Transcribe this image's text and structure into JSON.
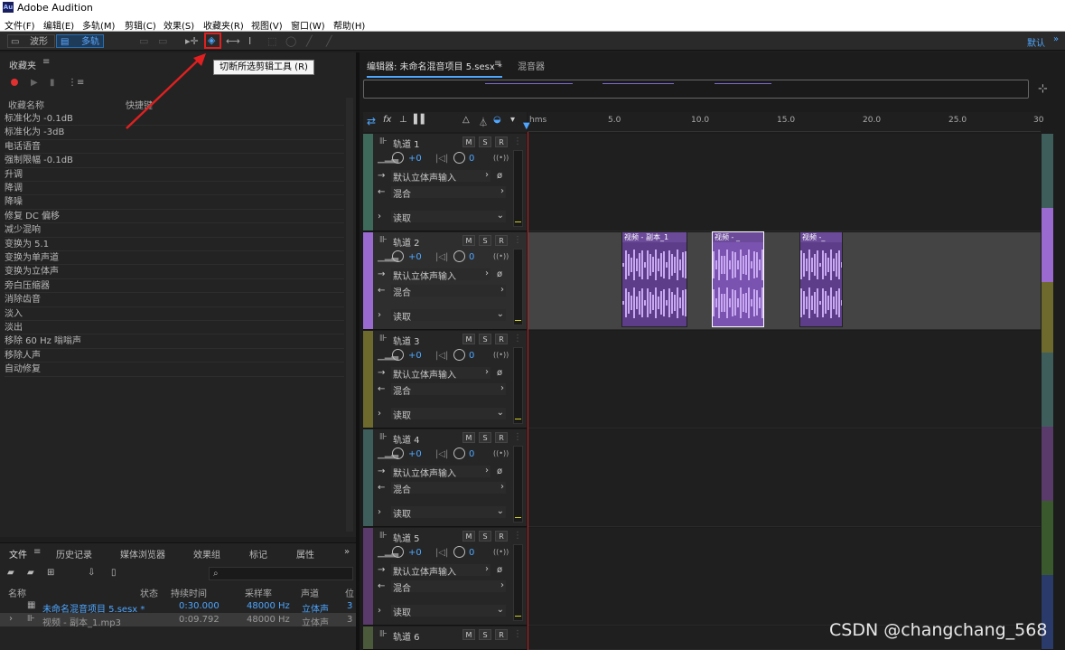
{
  "app": {
    "title": "Adobe Audition",
    "logo": "Au"
  },
  "menu": [
    "文件(F)",
    "编辑(E)",
    "多轨(M)",
    "剪辑(C)",
    "效果(S)",
    "收藏夹(R)",
    "视图(V)",
    "窗口(W)",
    "帮助(H)"
  ],
  "toolbar": {
    "waveform": "波形",
    "multitrack": "多轨",
    "workspace": "默认"
  },
  "tooltip": "切断所选剪辑工具 (R)",
  "favorites": {
    "title": "收藏夹",
    "col_name": "收藏名称",
    "col_shortcut": "快捷键",
    "items": [
      "标准化为 -0.1dB",
      "标准化为 -3dB",
      "电话语音",
      "强制限幅 -0.1dB",
      "升调",
      "降调",
      "降噪",
      "修复 DC 偏移",
      "减少混响",
      "变换为 5.1",
      "变换为单声道",
      "变换为立体声",
      "旁白压缩器",
      "消除齿音",
      "淡入",
      "淡出",
      "移除 60 Hz 嗡嗡声",
      "移除人声",
      "自动修复"
    ]
  },
  "files": {
    "tabs": [
      "文件",
      "历史记录",
      "媒体浏览器",
      "效果组",
      "标记",
      "属性"
    ],
    "headers": [
      "名称",
      "状态",
      "持续时间",
      "采样率",
      "声道",
      "位"
    ],
    "rows": [
      {
        "name": "未命名混音项目 5.sesx *",
        "duration": "0:30.000",
        "rate": "48000 Hz",
        "channels": "立体声",
        "bits": "3"
      },
      {
        "name": "视频 - 副本_1.mp3",
        "duration": "0:09.792",
        "rate": "48000 Hz",
        "channels": "立体声",
        "bits": "3"
      }
    ]
  },
  "editor": {
    "tab": "编辑器: 未命名混音项目 5.sesx *",
    "mixer": "混音器"
  },
  "ruler": [
    "hms",
    "5.0",
    "10.0",
    "15.0",
    "20.0",
    "25.0",
    "30"
  ],
  "tracks": [
    {
      "name": "轨道 1",
      "color": "#3d6a5a",
      "vol": "+0",
      "pan": "0",
      "input": "默认立体声输入",
      "output": "混合",
      "mode": "读取"
    },
    {
      "name": "轨道 2",
      "color": "#9a6ad0",
      "vol": "+0",
      "pan": "0",
      "input": "默认立体声输入",
      "output": "混合",
      "mode": "读取"
    },
    {
      "name": "轨道 3",
      "color": "#6e6a2e",
      "vol": "+0",
      "pan": "0",
      "input": "默认立体声输入",
      "output": "混合",
      "mode": "读取"
    },
    {
      "name": "轨道 4",
      "color": "#3d5e5a",
      "vol": "+0",
      "pan": "0",
      "input": "默认立体声输入",
      "output": "混合",
      "mode": "读取"
    },
    {
      "name": "轨道 5",
      "color": "#5a3a6a",
      "vol": "+0",
      "pan": "0",
      "input": "默认立体声输入",
      "output": "混合",
      "mode": "读取"
    },
    {
      "name": "轨道 6",
      "color": "#4a5a3a"
    }
  ],
  "clips": [
    "视频 - 副本_1",
    "视频 - _",
    "视频 -_"
  ],
  "watermark": "CSDN @changchang_568"
}
